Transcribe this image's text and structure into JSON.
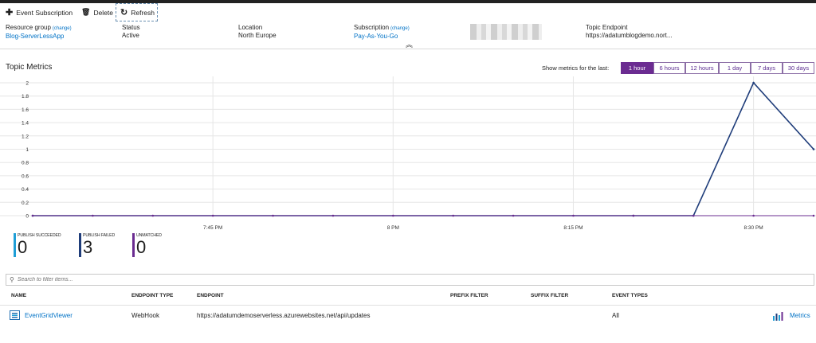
{
  "toolbar": {
    "event_subscription": "Event Subscription",
    "delete": "Delete",
    "refresh": "Refresh"
  },
  "essentials": {
    "resource_group": {
      "label": "Resource group",
      "change": "(change)",
      "value": "Blog-ServerLessApp"
    },
    "status": {
      "label": "Status",
      "value": "Active"
    },
    "location": {
      "label": "Location",
      "value": "North Europe"
    },
    "subscription": {
      "label": "Subscription",
      "change": "(change)",
      "value": "Pay-As-You-Go"
    },
    "topic_endpoint": {
      "label": "Topic Endpoint",
      "value": "https://adatumblogdemo.nort..."
    }
  },
  "metrics": {
    "title": "Topic Metrics",
    "show_label": "Show metrics for the last:",
    "ranges": [
      "1 hour",
      "6 hours",
      "12 hours",
      "1 day",
      "7 days",
      "30 days"
    ],
    "active_range": "1 hour"
  },
  "chart_data": {
    "type": "line",
    "y_ticks": [
      "2",
      "1.8",
      "1.6",
      "1.4",
      "1.2",
      "1",
      "0.8",
      "0.6",
      "0.4",
      "0.2",
      "0"
    ],
    "ylim": [
      0,
      2
    ],
    "x_ticks": [
      {
        "label": "7:45 PM",
        "minute": 15
      },
      {
        "label": "8 PM",
        "minute": 30
      },
      {
        "label": "8:15 PM",
        "minute": 45
      },
      {
        "label": "8:30 PM",
        "minute": 60
      }
    ],
    "grid": true,
    "series": [
      {
        "color": "#1f3d7a",
        "x_minutes": [
          0,
          50,
          55,
          60,
          65
        ],
        "y": [
          0,
          0,
          0,
          2,
          1
        ]
      },
      {
        "color": "#6b2c91",
        "x_minutes": [
          0,
          5,
          10,
          15,
          20,
          25,
          30,
          35,
          40,
          45,
          50,
          55,
          60,
          65
        ],
        "y": [
          0,
          0,
          0,
          0,
          0,
          0,
          0,
          0,
          0,
          0,
          0,
          0,
          0,
          0
        ]
      }
    ]
  },
  "tiles": [
    {
      "label": "PUBLISH SUCCEEDED",
      "value": "0",
      "color": "#1f9ed6"
    },
    {
      "label": "PUBLISH FAILED",
      "value": "3",
      "color": "#1f3d7a"
    },
    {
      "label": "UNMATCHED",
      "value": "0",
      "color": "#6b2c91"
    }
  ],
  "filter": {
    "placeholder": "Search to filter items..."
  },
  "table": {
    "headers": [
      "NAME",
      "ENDPOINT TYPE",
      "ENDPOINT",
      "PREFIX FILTER",
      "SUFFIX FILTER",
      "EVENT TYPES"
    ],
    "rows": [
      {
        "name": "EventGridViewer",
        "endpoint_type": "WebHook",
        "endpoint": "https://adatumdemoserverless.azurewebsites.net/api/updates",
        "prefix_filter": "",
        "suffix_filter": "",
        "event_types": "All",
        "metrics": "Metrics"
      }
    ]
  }
}
